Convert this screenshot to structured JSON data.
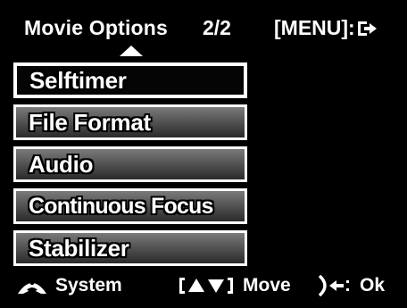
{
  "header": {
    "title": "Movie Options",
    "page_indicator": "2/2",
    "menu_hint": "[MENU]:",
    "exit_icon": "exit-arrow-icon",
    "scroll_up_icon": "triangle-up-icon"
  },
  "menu": {
    "items": [
      {
        "label": "Selftimer",
        "selected": true
      },
      {
        "label": "File Format",
        "selected": false
      },
      {
        "label": "Audio",
        "selected": false
      },
      {
        "label": "Continuous Focus",
        "selected": false
      },
      {
        "label": "Stabilizer",
        "selected": false
      }
    ]
  },
  "footer": {
    "system_label": "System",
    "system_icon": "system-wheel-icon",
    "move_label": "Move",
    "move_icon": "up-down-brackets-icon",
    "ok_label": "Ok",
    "ok_icon": "dial-arrow-icon"
  },
  "colors": {
    "background": "#000000",
    "text": "#ffffff",
    "item_border": "#ffffff",
    "item_gradient_top": "#7a7a7a",
    "item_gradient_bottom": "#2a2a2a",
    "selected_fill": "#050505"
  }
}
